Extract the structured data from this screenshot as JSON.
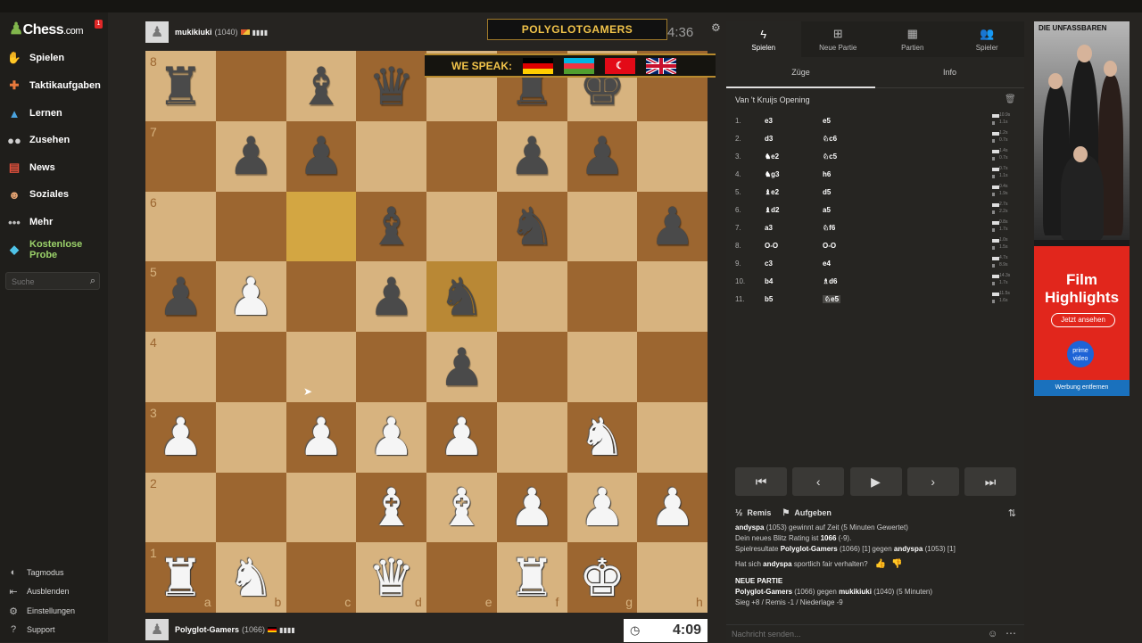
{
  "sidebar": {
    "logo": "Chess",
    "logo_domain": ".com",
    "notification_count": "1",
    "items": [
      {
        "label": "Spielen",
        "icon": "play-hand-icon"
      },
      {
        "label": "Taktikaufgaben",
        "icon": "puzzle-icon"
      },
      {
        "label": "Lernen",
        "icon": "learn-cap-icon"
      },
      {
        "label": "Zusehen",
        "icon": "binoculars-icon"
      },
      {
        "label": "News",
        "icon": "news-icon"
      },
      {
        "label": "Soziales",
        "icon": "social-icon"
      },
      {
        "label": "Mehr",
        "icon": "more-dots-icon"
      }
    ],
    "trial_label": "Kostenlose Probe",
    "search_placeholder": "Suche",
    "bottom": [
      "Tagmodus",
      "Ausblenden",
      "Einstellungen",
      "Support"
    ]
  },
  "top_player": {
    "name": "mukikiuki",
    "rating": "(1040)",
    "clock": "4:36"
  },
  "bottom_player": {
    "name": "Polyglot-Gamers",
    "rating": "(1066)",
    "clock": "4:09"
  },
  "stream_overlay": {
    "title": "POLYGLOTGAMERS",
    "speak": "WE SPEAK:"
  },
  "board": {
    "ranks": [
      "8",
      "7",
      "6",
      "5",
      "4",
      "3",
      "2",
      "1"
    ],
    "files": [
      "a",
      "b",
      "c",
      "d",
      "e",
      "f",
      "g",
      "h"
    ],
    "colors": {
      "light": "#d7b37f",
      "dark": "#9c6630",
      "highlight": "#d3a642"
    },
    "pieces": [
      {
        "sq": "a8",
        "p": "r"
      },
      {
        "sq": "c8",
        "p": "b"
      },
      {
        "sq": "d8",
        "p": "q"
      },
      {
        "sq": "f8",
        "p": "r"
      },
      {
        "sq": "g8",
        "p": "k"
      },
      {
        "sq": "b7",
        "p": "p"
      },
      {
        "sq": "c7",
        "p": "p"
      },
      {
        "sq": "f7",
        "p": "p"
      },
      {
        "sq": "g7",
        "p": "p"
      },
      {
        "sq": "d6",
        "p": "b"
      },
      {
        "sq": "f6",
        "p": "n"
      },
      {
        "sq": "h6",
        "p": "p"
      },
      {
        "sq": "a5",
        "p": "p"
      },
      {
        "sq": "b5",
        "p": "P"
      },
      {
        "sq": "d5",
        "p": "p"
      },
      {
        "sq": "e5",
        "p": "n"
      },
      {
        "sq": "e4",
        "p": "p"
      },
      {
        "sq": "a3",
        "p": "P"
      },
      {
        "sq": "c3",
        "p": "P"
      },
      {
        "sq": "d3",
        "p": "P"
      },
      {
        "sq": "e3",
        "p": "P"
      },
      {
        "sq": "g3",
        "p": "N"
      },
      {
        "sq": "d2",
        "p": "B"
      },
      {
        "sq": "e2",
        "p": "B"
      },
      {
        "sq": "f2",
        "p": "P"
      },
      {
        "sq": "g2",
        "p": "P"
      },
      {
        "sq": "h2",
        "p": "P"
      },
      {
        "sq": "a1",
        "p": "R"
      },
      {
        "sq": "b1",
        "p": "N"
      },
      {
        "sq": "d1",
        "p": "Q"
      },
      {
        "sq": "f1",
        "p": "R"
      },
      {
        "sq": "g1",
        "p": "K"
      }
    ],
    "highlights": [
      "c6",
      "e5"
    ]
  },
  "panel": {
    "tabs": [
      {
        "label": "Spielen",
        "icon": "bolt-icon"
      },
      {
        "label": "Neue Partie",
        "icon": "plus-square-icon"
      },
      {
        "label": "Partien",
        "icon": "checker-icon"
      },
      {
        "label": "Spieler",
        "icon": "players-icon"
      }
    ],
    "subtabs": [
      "Züge",
      "Info"
    ],
    "opening": "Van 't Kruijs Opening",
    "moves": [
      {
        "n": "1.",
        "w": "e3",
        "b": "e5",
        "tw": "10.9s",
        "tb": "1.1s"
      },
      {
        "n": "2.",
        "w": "d3",
        "b": "♘c6",
        "tw": "1.2s",
        "tb": "0.7s"
      },
      {
        "n": "3.",
        "w": "♞e2",
        "b": "♘c5",
        "tw": "1.4s",
        "tb": "0.7s"
      },
      {
        "n": "4.",
        "w": "♞g3",
        "b": "h6",
        "tw": "0.7s",
        "tb": "1.1s"
      },
      {
        "n": "5.",
        "w": "♝e2",
        "b": "d5",
        "tw": "0.4s",
        "tb": "1.9s"
      },
      {
        "n": "6.",
        "w": "♝d2",
        "b": "a5",
        "tw": "2.7s",
        "tb": "2.2s"
      },
      {
        "n": "7.",
        "w": "a3",
        "b": "♘f6",
        "tw": "0.8s",
        "tb": "1.7s"
      },
      {
        "n": "8.",
        "w": "O-O",
        "b": "O-O",
        "tw": "1.0s",
        "tb": "1.5s"
      },
      {
        "n": "9.",
        "w": "c3",
        "b": "e4",
        "tw": "4.7s",
        "tb": "8.9s"
      },
      {
        "n": "10.",
        "w": "b4",
        "b": "♗d6",
        "tw": "14.3s",
        "tb": "1.7s"
      },
      {
        "n": "11.",
        "w": "b5",
        "b": "♘e5",
        "tw": "11.5s",
        "tb": "1.6s"
      }
    ],
    "remis": "Remis",
    "resign": "Aufgeben",
    "chat": {
      "l1_name": "andyspa",
      "l1_rest": " (1053) gewinnt auf Zeit (5 Minuten Gewertet)",
      "l2": "Dein neues Blitz Rating ist ",
      "l2_val": "1066",
      "l2_tail": " (-9).",
      "l3_a": "Spielresultate ",
      "l3_b": "Polyglot-Gamers",
      "l3_c": " (1066) [1] gegen ",
      "l3_d": "andyspa",
      "l3_e": " (1053) [1]",
      "l4_a": "Hat sich ",
      "l4_b": "andyspa",
      "l4_c": " sportlich fair verhalten?",
      "np": "NEUE PARTIE",
      "l5_a": "Polyglot-Gamers",
      "l5_b": " (1066) gegen ",
      "l5_c": "mukikiuki",
      "l5_d": " (1040) (5 Minuten)",
      "l6": "Sieg +8 / Remis -1 / Niederlage -9"
    },
    "chat_placeholder": "Nachricht senden..."
  },
  "ad": {
    "title": "DIE UNFASSBAREN",
    "headline": "Film Highlights",
    "cta": "Jetzt ansehen",
    "brand": "prime video",
    "footer": "Werbung entfernen"
  }
}
